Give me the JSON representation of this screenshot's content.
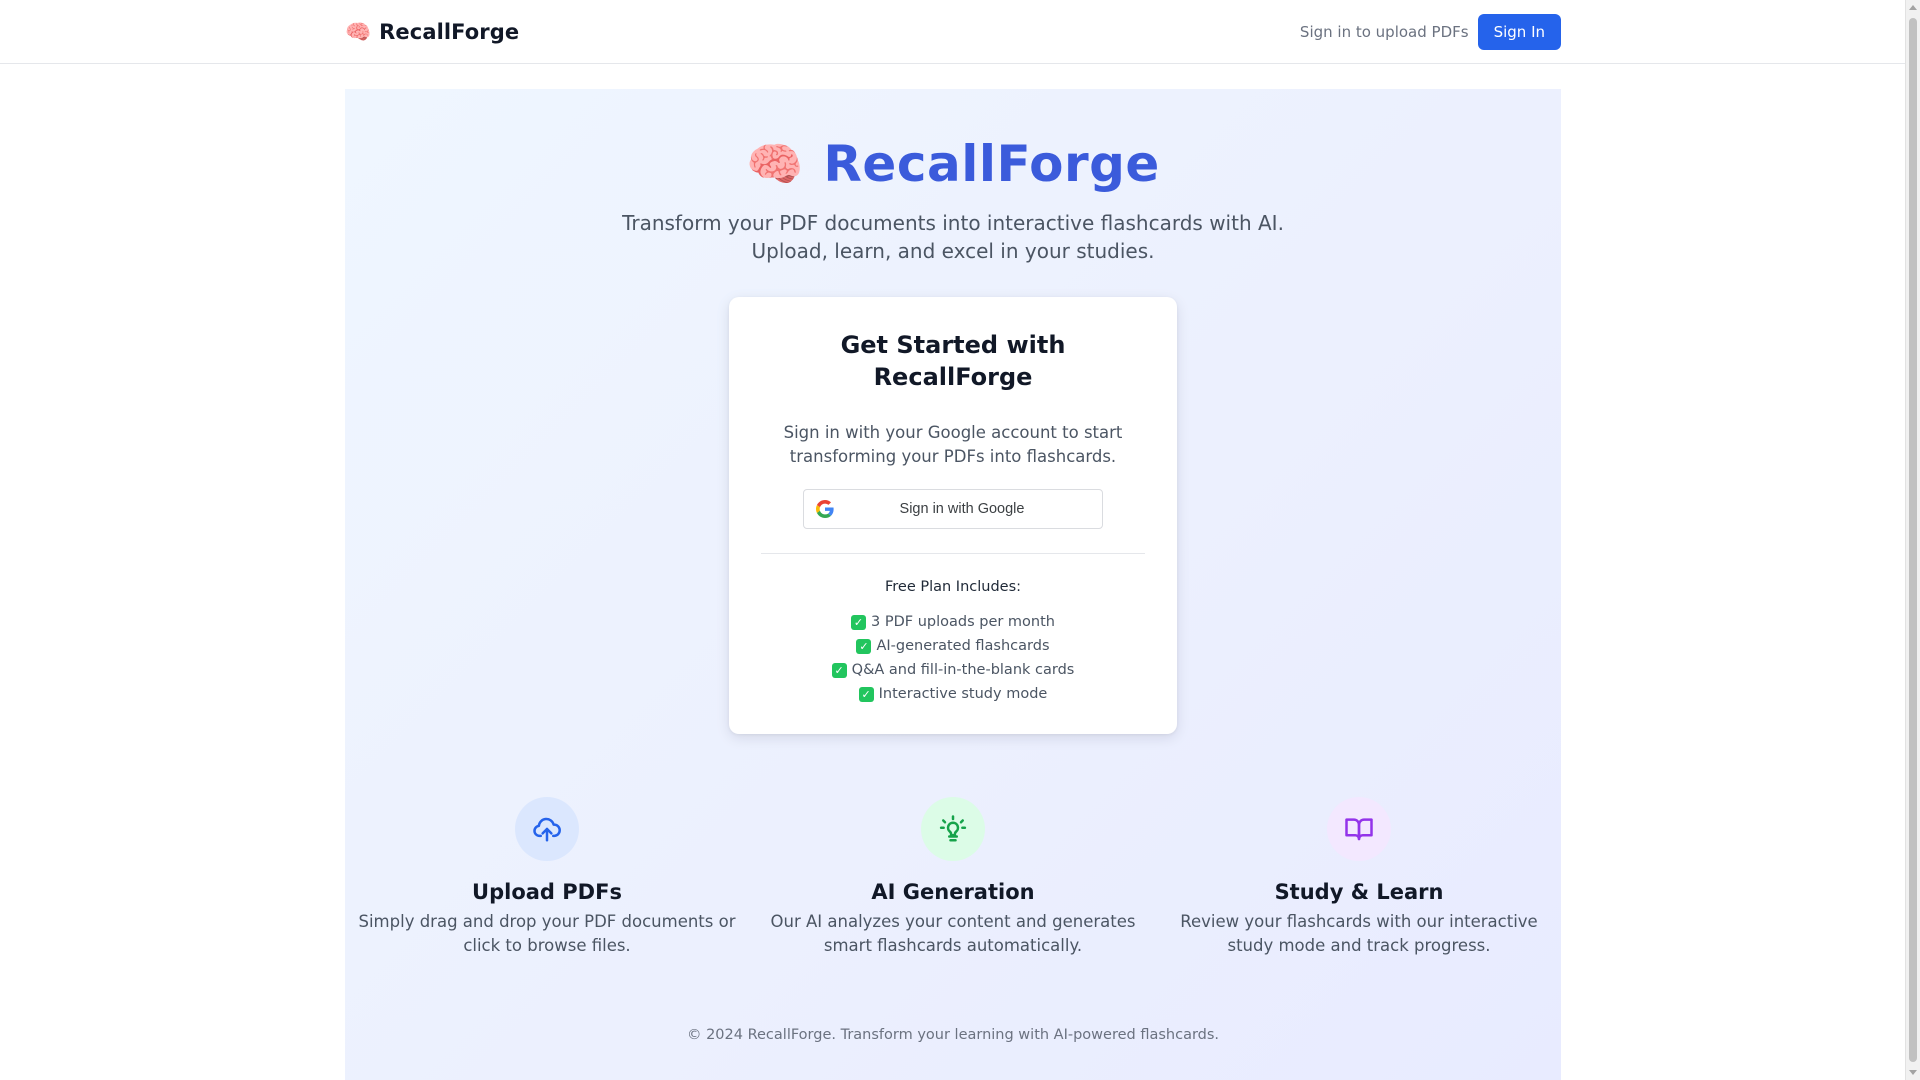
{
  "header": {
    "brand_emoji": "🧠",
    "brand_name": "RecallForge",
    "hint": "Sign in to upload PDFs",
    "sign_in_label": "Sign In"
  },
  "hero": {
    "emoji": "🧠",
    "title": "RecallForge",
    "subtitle_line1": "Transform your PDF documents into interactive flashcards with AI.",
    "subtitle_line2": "Upload, learn, and excel in your studies."
  },
  "card": {
    "title_line1": "Get Started with",
    "title_line2": "RecallForge",
    "text_line1": "Sign in with your Google account to start",
    "text_line2": "transforming your PDFs into flashcards.",
    "google_button_label": "Sign in with Google",
    "plan_title": "Free Plan Includes:",
    "plan_items": [
      "3 PDF uploads per month",
      "AI-generated flashcards",
      "Q&A and fill-in-the-blank cards",
      "Interactive study mode"
    ]
  },
  "features": [
    {
      "icon": "upload-cloud-icon",
      "title": "Upload PDFs",
      "text_line1": "Simply drag and drop your PDF documents or",
      "text_line2": "click to browse files."
    },
    {
      "icon": "lightbulb-icon",
      "title": "AI Generation",
      "text_line1": "Our AI analyzes your content and generates",
      "text_line2": "smart flashcards automatically."
    },
    {
      "icon": "open-book-icon",
      "title": "Study & Learn",
      "text_line1": "Review your flashcards with our interactive",
      "text_line2": "study mode and track progress."
    }
  ],
  "footer": {
    "text": "© 2024 RecallForge. Transform your learning with AI-powered flashcards."
  },
  "colors": {
    "primary_button": "#2563eb",
    "hero_title": "#3b5bdb",
    "upload_icon": "#2563eb",
    "ai_icon": "#16a34a",
    "study_icon": "#9333ea"
  }
}
